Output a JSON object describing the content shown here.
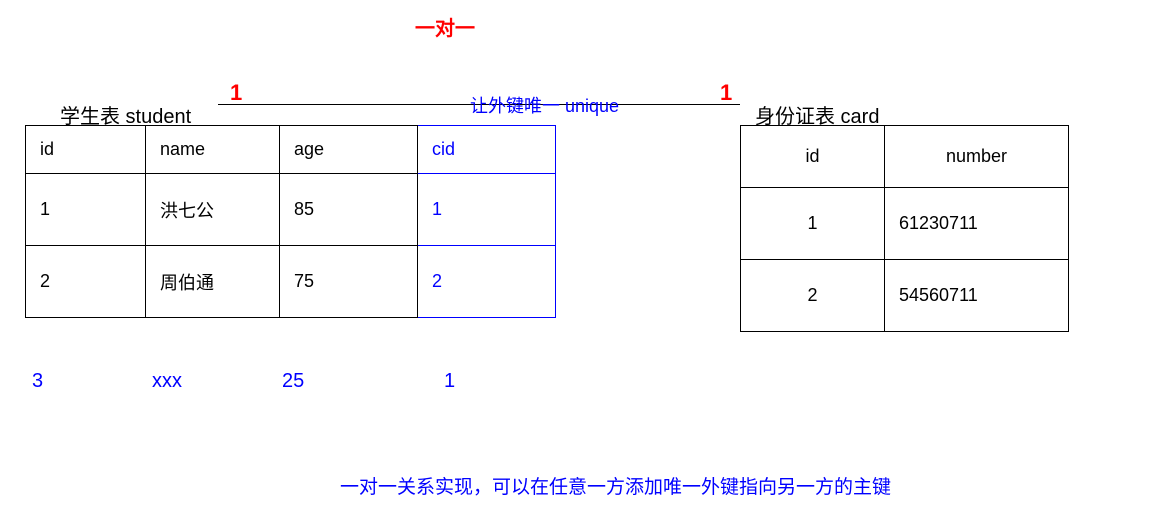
{
  "title": "一对一",
  "one_left": "1",
  "one_right": "1",
  "unique_label": "让外键唯一 unique",
  "student": {
    "caption": "学生表 student",
    "headers": {
      "id": "id",
      "name": "name",
      "age": "age",
      "cid": "cid"
    },
    "rows": [
      {
        "id": "1",
        "name": "洪七公",
        "age": "85",
        "cid": "1"
      },
      {
        "id": "2",
        "name": "周伯通",
        "age": "75",
        "cid": "2"
      }
    ],
    "extra_row": {
      "id": "3",
      "name": "xxx",
      "age": "25",
      "cid": "1"
    }
  },
  "card": {
    "caption": "身份证表  card",
    "headers": {
      "id": "id",
      "number": "number"
    },
    "rows": [
      {
        "id": "1",
        "number": "61230711"
      },
      {
        "id": "2",
        "number": "54560711"
      }
    ]
  },
  "bottom_note": "一对一关系实现，可以在任意一方添加唯一外键指向另一方的主键"
}
